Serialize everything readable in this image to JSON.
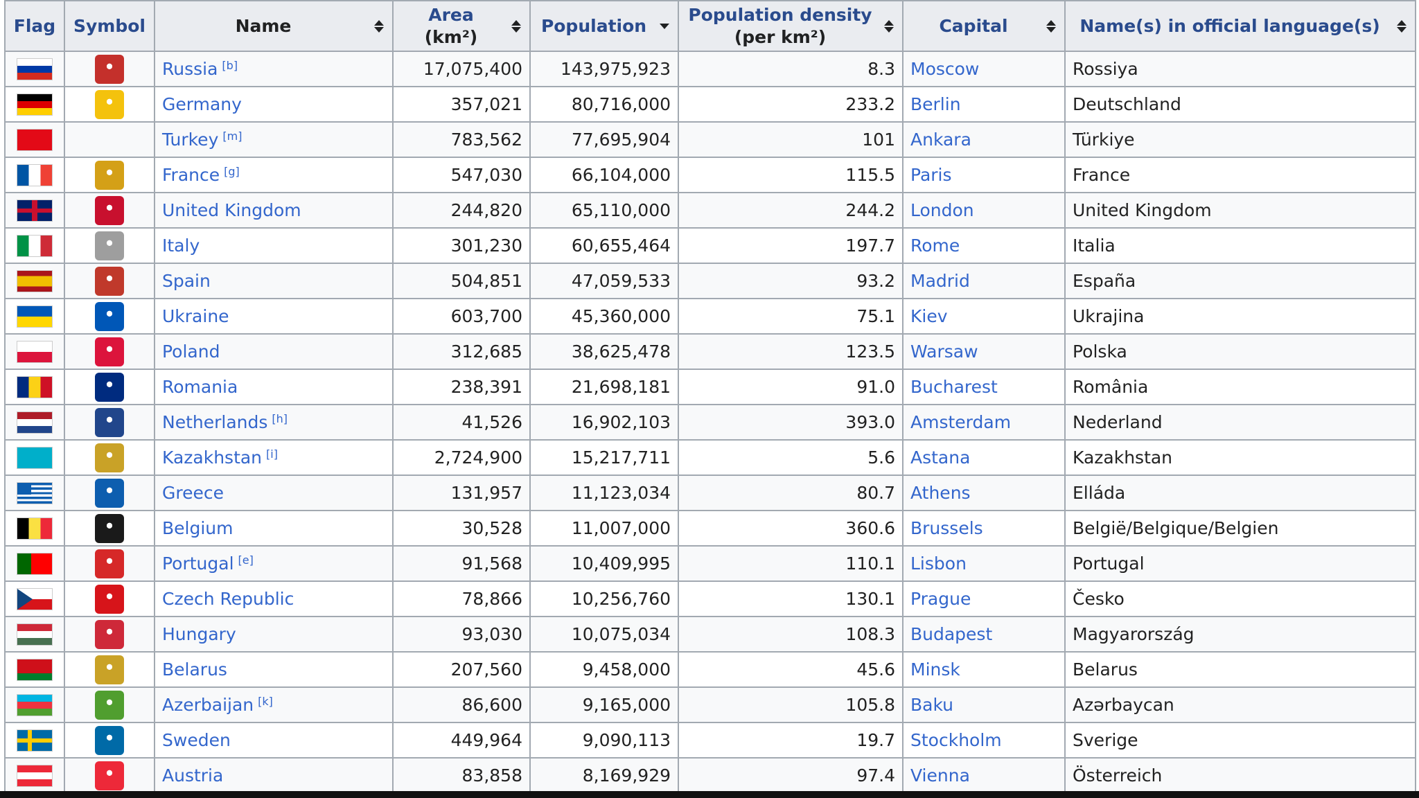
{
  "headers": [
    {
      "key": "flag",
      "label": "Flag",
      "sub": "",
      "sortable": false,
      "link": true
    },
    {
      "key": "symbol",
      "label": "Symbol",
      "sub": "",
      "sortable": false,
      "link": true
    },
    {
      "key": "name",
      "label": "Name",
      "sub": "",
      "sortable": true,
      "link": false
    },
    {
      "key": "area",
      "label": "Area",
      "sub": "(km²)",
      "sortable": true,
      "link": true
    },
    {
      "key": "population",
      "label": "Population",
      "sub": "",
      "sortable": true,
      "link": true,
      "sorted": "desc"
    },
    {
      "key": "density",
      "label": "Population density",
      "sub": "(per km²)",
      "sortable": true,
      "link": true
    },
    {
      "key": "capital",
      "label": "Capital",
      "sub": "",
      "sortable": true,
      "link": true
    },
    {
      "key": "official",
      "label": "Name(s) in official language(s)",
      "sub": "",
      "sortable": true,
      "link": true
    }
  ],
  "rows": [
    {
      "name": "Russia",
      "note": "[b]",
      "area": "17,075,400",
      "population": "143,975,923",
      "density": "8.3",
      "capital": "Moscow",
      "official": "Rossiya",
      "flag": "russia-flag",
      "symbol": "russia-coat-of-arms",
      "colors": [
        "#ffffff",
        "#0039a6",
        "#d52b1e"
      ],
      "flag_layout": "h3",
      "symbol_color": "#c4302b"
    },
    {
      "name": "Germany",
      "note": "",
      "area": "357,021",
      "population": "80,716,000",
      "density": "233.2",
      "capital": "Berlin",
      "official": "Deutschland",
      "flag": "germany-flag",
      "symbol": "germany-coat-of-arms",
      "colors": [
        "#000000",
        "#dd0000",
        "#ffce00"
      ],
      "flag_layout": "h3",
      "symbol_color": "#f4c20d"
    },
    {
      "name": "Turkey",
      "note": "[m]",
      "area": "783,562",
      "population": "77,695,904",
      "density": "101",
      "capital": "Ankara",
      "official": "Türkiye",
      "flag": "turkey-flag",
      "symbol": "",
      "colors": [
        "#e30a17"
      ],
      "flag_layout": "solid",
      "symbol_color": ""
    },
    {
      "name": "France",
      "note": "[g]",
      "area": "547,030",
      "population": "66,104,000",
      "density": "115.5",
      "capital": "Paris",
      "official": "France",
      "flag": "france-flag",
      "symbol": "france-emblem",
      "colors": [
        "#0055a4",
        "#ffffff",
        "#ef4135"
      ],
      "flag_layout": "v3",
      "symbol_color": "#d4a017"
    },
    {
      "name": "United Kingdom",
      "note": "",
      "area": "244,820",
      "population": "65,110,000",
      "density": "244.2",
      "capital": "London",
      "official": "United Kingdom",
      "flag": "united-kingdom-flag",
      "symbol": "united-kingdom-coat-of-arms",
      "colors": [
        "#012169",
        "#ffffff",
        "#c8102e"
      ],
      "flag_layout": "uk",
      "symbol_color": "#c8102e"
    },
    {
      "name": "Italy",
      "note": "",
      "area": "301,230",
      "population": "60,655,464",
      "density": "197.7",
      "capital": "Rome",
      "official": "Italia",
      "flag": "italy-flag",
      "symbol": "italy-emblem",
      "colors": [
        "#009246",
        "#ffffff",
        "#ce2b37"
      ],
      "flag_layout": "v3",
      "symbol_color": "#9e9e9e"
    },
    {
      "name": "Spain",
      "note": "",
      "area": "504,851",
      "population": "47,059,533",
      "density": "93.2",
      "capital": "Madrid",
      "official": "España",
      "flag": "spain-flag",
      "symbol": "spain-coat-of-arms",
      "colors": [
        "#aa151b",
        "#f1bf00",
        "#aa151b"
      ],
      "flag_layout": "spain",
      "symbol_color": "#c0392b"
    },
    {
      "name": "Ukraine",
      "note": "",
      "area": "603,700",
      "population": "45,360,000",
      "density": "75.1",
      "capital": "Kiev",
      "official": "Ukrajina",
      "flag": "ukraine-flag",
      "symbol": "ukraine-trident",
      "colors": [
        "#0057b7",
        "#ffd700"
      ],
      "flag_layout": "h2",
      "symbol_color": "#0057b7"
    },
    {
      "name": "Poland",
      "note": "",
      "area": "312,685",
      "population": "38,625,478",
      "density": "123.5",
      "capital": "Warsaw",
      "official": "Polska",
      "flag": "poland-flag",
      "symbol": "poland-eagle",
      "colors": [
        "#ffffff",
        "#dc143c"
      ],
      "flag_layout": "h2",
      "symbol_color": "#dc143c"
    },
    {
      "name": "Romania",
      "note": "",
      "area": "238,391",
      "population": "21,698,181",
      "density": "91.0",
      "capital": "Bucharest",
      "official": "România",
      "flag": "romania-flag",
      "symbol": "romania-coat-of-arms",
      "colors": [
        "#002b7f",
        "#fcd116",
        "#ce1126"
      ],
      "flag_layout": "v3",
      "symbol_color": "#002b7f"
    },
    {
      "name": "Netherlands",
      "note": "[h]",
      "area": "41,526",
      "population": "16,902,103",
      "density": "393.0",
      "capital": "Amsterdam",
      "official": "Nederland",
      "flag": "netherlands-flag",
      "symbol": "netherlands-coat-of-arms",
      "colors": [
        "#ae1c28",
        "#ffffff",
        "#21468b"
      ],
      "flag_layout": "h3",
      "symbol_color": "#21468b"
    },
    {
      "name": "Kazakhstan",
      "note": "[i]",
      "area": "2,724,900",
      "population": "15,217,711",
      "density": "5.6",
      "capital": "Astana",
      "official": "Kazakhstan",
      "flag": "kazakhstan-flag",
      "symbol": "kazakhstan-emblem",
      "colors": [
        "#00afca"
      ],
      "flag_layout": "solid",
      "symbol_color": "#c9a227"
    },
    {
      "name": "Greece",
      "note": "",
      "area": "131,957",
      "population": "11,123,034",
      "density": "80.7",
      "capital": "Athens",
      "official": "Elláda",
      "flag": "greece-flag",
      "symbol": "greece-coat-of-arms",
      "colors": [
        "#0d5eaf",
        "#ffffff"
      ],
      "flag_layout": "stripes",
      "symbol_color": "#0d5eaf"
    },
    {
      "name": "Belgium",
      "note": "",
      "area": "30,528",
      "population": "11,007,000",
      "density": "360.6",
      "capital": "Brussels",
      "official": "België/Belgique/Belgien",
      "flag": "belgium-flag",
      "symbol": "belgium-lion",
      "colors": [
        "#000000",
        "#fae042",
        "#ed2939"
      ],
      "flag_layout": "v3",
      "symbol_color": "#1a1a1a"
    },
    {
      "name": "Portugal",
      "note": "[e]",
      "area": "91,568",
      "population": "10,409,995",
      "density": "110.1",
      "capital": "Lisbon",
      "official": "Portugal",
      "flag": "portugal-flag",
      "symbol": "portugal-coat-of-arms",
      "colors": [
        "#006600",
        "#ff0000"
      ],
      "flag_layout": "portugal",
      "symbol_color": "#d62828"
    },
    {
      "name": "Czech Republic",
      "note": "",
      "area": "78,866",
      "population": "10,256,760",
      "density": "130.1",
      "capital": "Prague",
      "official": "Česko",
      "flag": "czech-republic-flag",
      "symbol": "czech-republic-coat-of-arms",
      "colors": [
        "#ffffff",
        "#d7141a",
        "#11457e"
      ],
      "flag_layout": "czech",
      "symbol_color": "#d7141a"
    },
    {
      "name": "Hungary",
      "note": "",
      "area": "93,030",
      "population": "10,075,034",
      "density": "108.3",
      "capital": "Budapest",
      "official": "Magyarország",
      "flag": "hungary-flag",
      "symbol": "hungary-coat-of-arms",
      "colors": [
        "#ce2939",
        "#ffffff",
        "#477050"
      ],
      "flag_layout": "h3",
      "symbol_color": "#ce2939"
    },
    {
      "name": "Belarus",
      "note": "",
      "area": "207,560",
      "population": "9,458,000",
      "density": "45.6",
      "capital": "Minsk",
      "official": "Belarus",
      "flag": "belarus-flag",
      "symbol": "belarus-emblem",
      "colors": [
        "#cf101a",
        "#007d2c"
      ],
      "flag_layout": "belarus",
      "symbol_color": "#c9a227"
    },
    {
      "name": "Azerbaijan",
      "note": "[k]",
      "area": "86,600",
      "population": "9,165,000",
      "density": "105.8",
      "capital": "Baku",
      "official": "Azərbaycan",
      "flag": "azerbaijan-flag",
      "symbol": "azerbaijan-emblem",
      "colors": [
        "#00b5e2",
        "#ef3340",
        "#509e2f"
      ],
      "flag_layout": "h3",
      "symbol_color": "#509e2f"
    },
    {
      "name": "Sweden",
      "note": "",
      "area": "449,964",
      "population": "9,090,113",
      "density": "19.7",
      "capital": "Stockholm",
      "official": "Sverige",
      "flag": "sweden-flag",
      "symbol": "sweden-coat-of-arms",
      "colors": [
        "#006aa7",
        "#fecc00"
      ],
      "flag_layout": "nordic",
      "symbol_color": "#006aa7"
    },
    {
      "name": "Austria",
      "note": "",
      "area": "83,858",
      "population": "8,169,929",
      "density": "97.4",
      "capital": "Vienna",
      "official": "Österreich",
      "flag": "austria-flag",
      "symbol": "austria-shield",
      "colors": [
        "#ed2939",
        "#ffffff",
        "#ed2939"
      ],
      "flag_layout": "h3",
      "symbol_color": "#ed2939"
    }
  ]
}
